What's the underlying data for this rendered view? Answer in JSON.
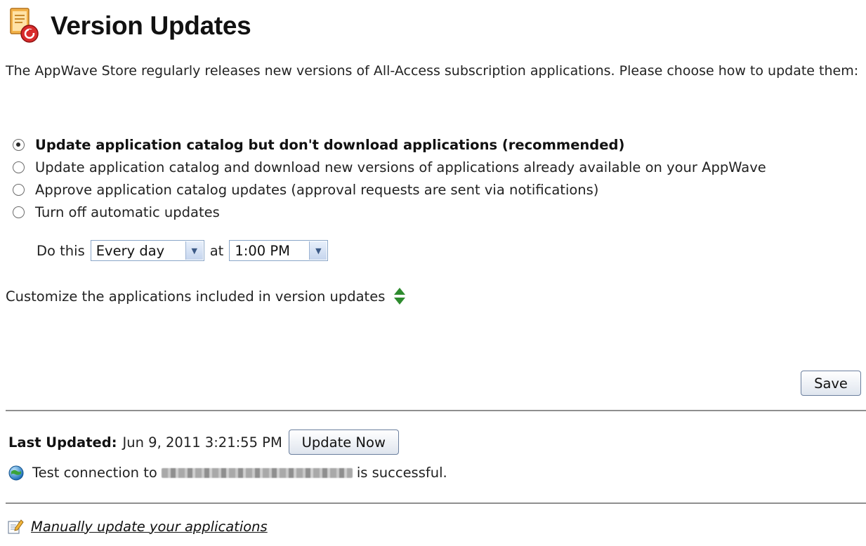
{
  "page": {
    "title": "Version Updates",
    "intro": "The AppWave Store regularly releases new versions of All-Access subscription applications. Please choose how to update them:"
  },
  "options": [
    {
      "label": "Update application catalog but don't download applications (recommended)",
      "selected": true
    },
    {
      "label": "Update application catalog and download new versions of applications already available on your AppWave",
      "selected": false
    },
    {
      "label": "Approve application catalog updates (approval requests are sent via notifications)",
      "selected": false
    },
    {
      "label": "Turn off automatic updates",
      "selected": false
    }
  ],
  "schedule": {
    "do_this_label": "Do this",
    "frequency": "Every day",
    "at_label": "at",
    "time": "1:00 PM"
  },
  "customize": {
    "label": "Customize the applications included in version updates",
    "icon": "expand-collapse-icon"
  },
  "save_label": "Save",
  "status": {
    "last_updated_label": "Last Updated:",
    "last_updated_value": "Jun 9, 2011 3:21:55 PM",
    "update_now_label": "Update Now",
    "connection_prefix": "Test connection to",
    "connection_suffix": "is successful.",
    "connection_icon": "globe-icon"
  },
  "manual": {
    "link_label": "Manually update your applications",
    "icon": "edit-document-icon"
  },
  "colors": {
    "link_text": "#111111",
    "toggle_green": "#2e8b2e",
    "button_border": "#6b7f9e",
    "select_border": "#8aa6c8"
  }
}
